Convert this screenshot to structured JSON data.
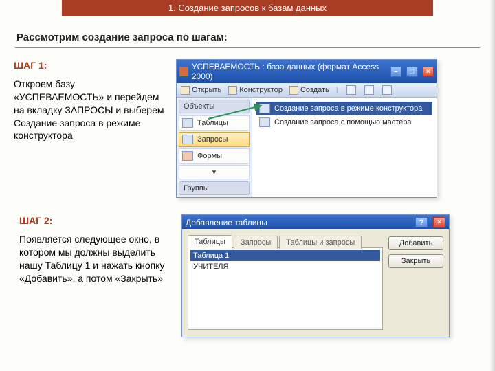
{
  "banner": "1. Создание запросов к базам данных",
  "subtitle": "Рассмотрим создание запроса по шагам:",
  "step1": {
    "label": "ШАГ 1:",
    "text": "Откроем базу «УСПЕВАЕМОСТЬ» и перейдем на вкладку ЗАПРОСЫ и выберем Создание запроса в режиме конструктора",
    "win_title": "УСПЕВАЕМОСТЬ : база данных (формат Access 2000)",
    "toolbar": {
      "open": "Открыть",
      "design": "Конструктор",
      "create": "Создать"
    },
    "sidebar": {
      "header": "Объекты",
      "tables": "Таблицы",
      "queries": "Запросы",
      "forms": "Формы",
      "groups": "Группы"
    },
    "options": {
      "designer": "Создание запроса в режиме конструктора",
      "wizard": "Создание запроса с помощью мастера"
    }
  },
  "step2": {
    "label": "ШАГ 2:",
    "text": "Появляется следующее окно, в котором мы должны выделить нашу Таблицу 1 и нажать кнопку «Добавить», а потом «Закрыть»",
    "win_title": "Добавление таблицы",
    "tabs": {
      "t1": "Таблицы",
      "t2": "Запросы",
      "t3": "Таблицы и запросы"
    },
    "list": {
      "item1": "Таблица 1",
      "item2": "УЧИТЕЛЯ"
    },
    "buttons": {
      "add": "Добавить",
      "close": "Закрыть"
    }
  }
}
